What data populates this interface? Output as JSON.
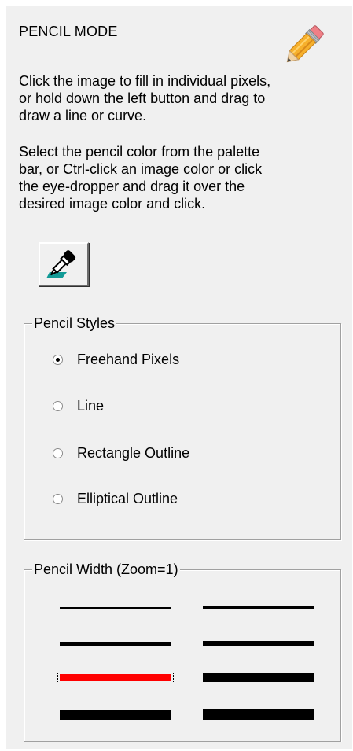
{
  "panel": {
    "title": "PENCIL MODE",
    "icon": "pencil-icon",
    "instructions": [
      "Click the image to fill in individual pixels,",
      "or hold down the left button and drag to",
      "draw a line or curve."
    ],
    "color_instructions": [
      "Select the pencil color from the palette",
      "bar, or Ctrl-click an image color or click",
      "the eye-dropper and drag it over the",
      "desired image color and click."
    ],
    "eyedropper_icon": "eyedropper-icon"
  },
  "pencil_styles": {
    "legend": "Pencil Styles",
    "options": [
      {
        "label": "Freehand Pixels",
        "checked": true
      },
      {
        "label": "Line",
        "checked": false
      },
      {
        "label": "Rectangle Outline",
        "checked": false
      },
      {
        "label": "Elliptical Outline",
        "checked": false
      }
    ]
  },
  "pencil_width": {
    "legend": "Pencil Width (Zoom=1)",
    "selected_color": "#ff0000",
    "left_widths": [
      {
        "value": 1,
        "selected": false
      },
      {
        "value": 3,
        "selected": false
      },
      {
        "value": 5,
        "selected": true
      },
      {
        "value": 7,
        "selected": false
      }
    ],
    "right_widths": [
      {
        "value": 2,
        "selected": false
      },
      {
        "value": 4,
        "selected": false
      },
      {
        "value": 6,
        "selected": false
      },
      {
        "value": 8,
        "selected": false
      }
    ]
  }
}
